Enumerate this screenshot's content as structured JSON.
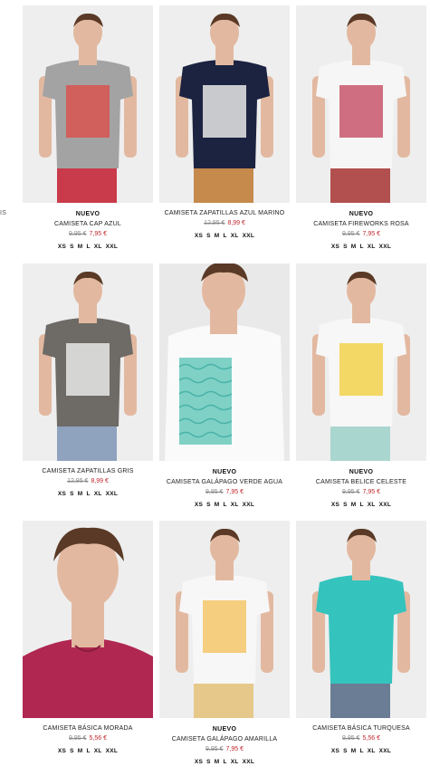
{
  "breadcrumb_fragment": "IS",
  "sizes": [
    "XS",
    "S",
    "M",
    "L",
    "XL",
    "XXL"
  ],
  "colors": {
    "price_new": "#c1272d",
    "price_old": "#888888",
    "image_bg": "#eeeeee"
  },
  "products": [
    {
      "tag": "NUEVO",
      "name": "CAMISETA CAP AZUL",
      "old_price": "9,95 €",
      "price": "7,95 €",
      "shirt": "#a3a3a3",
      "print": "shoes-pattern",
      "pants": "#c93b4b"
    },
    {
      "tag": "",
      "name": "CAMISETA ZAPATILLAS AZUL MARINO",
      "old_price": "12,95 €",
      "price": "8,99 €",
      "shirt": "#1c2340",
      "print": "sneakers",
      "pants": "#c58a4c"
    },
    {
      "tag": "NUEVO",
      "name": "CAMISETA FIREWORKS ROSA",
      "old_price": "9,95 €",
      "price": "7,95 €",
      "shirt": "#f6f6f6",
      "print": "pink-pattern",
      "pants": "#b24f4f"
    },
    {
      "tag": "",
      "name": "CAMISETA ZAPATILLAS GRIS",
      "old_price": "12,95 €",
      "price": "8,99 €",
      "shirt": "#6e6a66",
      "print": "sneakers",
      "pants": "#8fa3bf"
    },
    {
      "tag": "NUEVO",
      "name": "CAMISETA GALÁPAGO VERDE AGUA",
      "old_price": "9,95 €",
      "price": "7,95 €",
      "shirt": "#fafafa",
      "print": "turtles-aqua",
      "pants": ""
    },
    {
      "tag": "NUEVO",
      "name": "CAMISETA BELICE CELESTE",
      "old_price": "9,95 €",
      "price": "7,95 €",
      "shirt": "#f7f7f7",
      "print": "yellow-leaves",
      "pants": "#a9d6cf"
    },
    {
      "tag": "",
      "name": "CAMISETA BÁSICA MORADA",
      "old_price": "9,95 €",
      "price": "5,56 €",
      "shirt": "#b02752",
      "print": "",
      "pants": ""
    },
    {
      "tag": "NUEVO",
      "name": "CAMISETA GALÁPAGO AMARILLA",
      "old_price": "9,95 €",
      "price": "7,95 €",
      "shirt": "#f7f7f7",
      "print": "turtles-yellow",
      "pants": "#e6c98a"
    },
    {
      "tag": "",
      "name": "CAMISETA BÁSICA TURQUESA",
      "old_price": "9,95 €",
      "price": "5,56 €",
      "shirt": "#35c3bd",
      "print": "",
      "pants": "#6a7d94"
    }
  ]
}
